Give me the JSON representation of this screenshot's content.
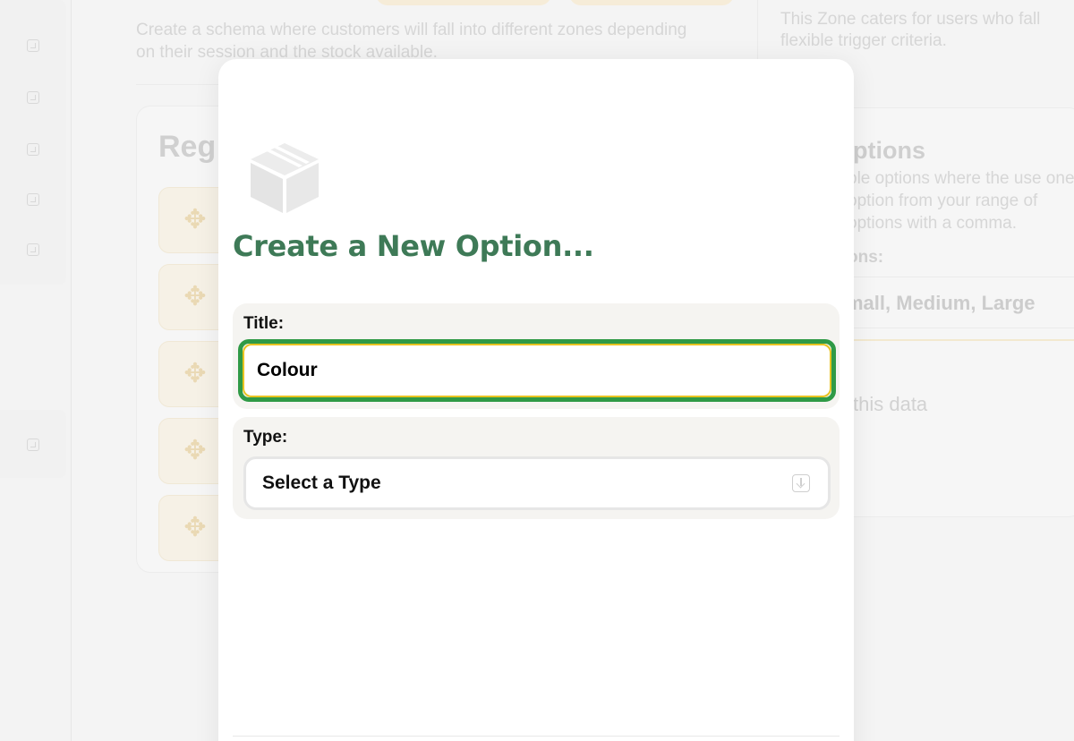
{
  "background": {
    "description": "Create a schema where customers will fall into different zones depending on their session and the stock available.",
    "description_right": "This Zone caters for users who fall flexible trigger criteria.",
    "left_card_title": "Reg",
    "options_title": "ptions",
    "options_desc": "ble options where the use one option from your range of options with a comma.",
    "options_label": "ons:",
    "options_values": "mall, Medium, Large",
    "no_data": "this data"
  },
  "modal": {
    "title": "Create a New Option...",
    "title_field": {
      "label": "Title:",
      "value": "Colour"
    },
    "type_field": {
      "label": "Type:",
      "selected": "Select a Type"
    }
  },
  "colors": {
    "title_green": "#3e7a57",
    "focus_green": "#2f9a46",
    "input_border_yellow": "#e8c320"
  },
  "icons": {
    "modal_header": "box-icon",
    "drag_tiles": "move-icon",
    "select_chevron": "chevron-down-icon"
  }
}
